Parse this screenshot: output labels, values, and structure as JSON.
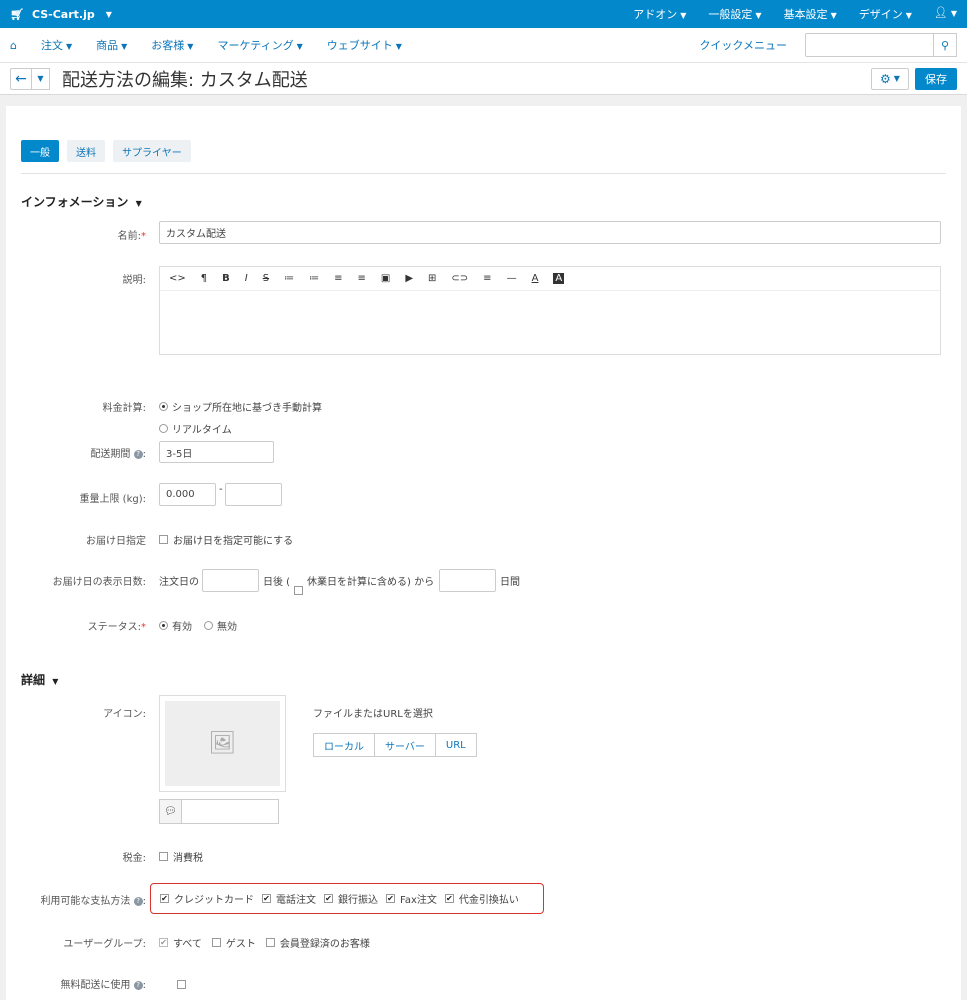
{
  "topbar": {
    "brand": "CS-Cart.jp",
    "menu": [
      "アドオン",
      "一般設定",
      "基本設定",
      "デザイン"
    ]
  },
  "nav": {
    "items": [
      "注文",
      "商品",
      "お客様",
      "マーケティング",
      "ウェブサイト"
    ],
    "quick_menu": "クイックメニュー",
    "search_placeholder": ""
  },
  "title": {
    "text": "配送方法の編集: カスタム配送",
    "save": "保存"
  },
  "tabs": [
    "一般",
    "送料",
    "サプライヤー"
  ],
  "info": {
    "heading": "インフォメーション",
    "name_label": "名前:",
    "name_value": "カスタム配送",
    "desc_label": "説明:",
    "toolbar": [
      "<>",
      "¶",
      "B",
      "I",
      "S",
      "≔",
      "≔",
      "≡",
      "≡",
      "▣",
      "▶",
      "⊞",
      "⊂⊃",
      "≡",
      "—",
      "A",
      "A"
    ],
    "rate_label": "料金計算:",
    "rate_opt1": "ショップ所在地に基づき手動計算",
    "rate_opt2": "リアルタイム",
    "period_label": "配送期間",
    "period_value": "3-5日",
    "weight_label": "重量上限 (kg):",
    "weight_min": "0.000",
    "weight_sep": "-",
    "weight_max": "",
    "date_label": "お届け日指定",
    "date_opt": "お届け日を指定可能にする",
    "days_label": "お届け日の表示日数:",
    "days_prefix": "注文日の",
    "days_mid1": "日後 (",
    "days_holiday": "休業日を計算に含める) から",
    "days_suffix": "日間",
    "status_label": "ステータス:",
    "status_on": "有効",
    "status_off": "無効"
  },
  "detail": {
    "heading": "詳細",
    "icon_label": "アイコン:",
    "file_label": "ファイルまたはURLを選択",
    "btn_local": "ローカル",
    "btn_server": "サーバー",
    "btn_url": "URL",
    "tax_label": "税金:",
    "tax_opt": "消費税",
    "pay_label": "利用可能な支払方法",
    "payments": [
      "クレジットカード",
      "電話注文",
      "銀行振込",
      "Fax注文",
      "代金引換払い"
    ],
    "group_label": "ユーザーグループ:",
    "groups": [
      "すべて",
      "ゲスト",
      "会員登録済のお客様"
    ],
    "free_label": "無料配送に使用"
  }
}
